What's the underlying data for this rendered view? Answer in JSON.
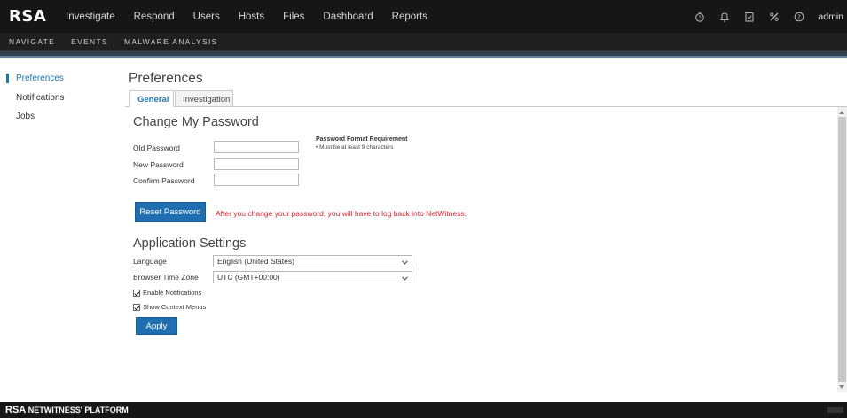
{
  "brand": "RSA",
  "topnav": {
    "items": [
      "Investigate",
      "Respond",
      "Users",
      "Hosts",
      "Files",
      "Dashboard",
      "Reports"
    ],
    "icons": [
      "timer-icon",
      "bell-icon",
      "clipboard-check-icon",
      "tools-icon",
      "help-icon"
    ],
    "user": "admin"
  },
  "subnav": {
    "items": [
      "NAVIGATE",
      "EVENTS",
      "MALWARE ANALYSIS"
    ]
  },
  "sidebar": {
    "items": [
      {
        "label": "Preferences",
        "active": true
      },
      {
        "label": "Notifications",
        "active": false
      },
      {
        "label": "Jobs",
        "active": false
      }
    ]
  },
  "page": {
    "title": "Preferences",
    "tabs": [
      "General",
      "Investigation"
    ],
    "active_tab": "General"
  },
  "password_section": {
    "title": "Change My Password",
    "fields": {
      "old": {
        "label": "Old Password",
        "value": ""
      },
      "new": {
        "label": "New Password",
        "value": ""
      },
      "confirm": {
        "label": "Confirm Password",
        "value": ""
      }
    },
    "requirement_title": "Password Format Requirement",
    "requirement_item": "• Must be at least 9 characters",
    "reset_button": "Reset Password",
    "warning": "After you change your password, you will have to log back into NetWitness."
  },
  "app_settings": {
    "title": "Application Settings",
    "language_label": "Language",
    "language_value": "English (United States)",
    "timezone_label": "Browser Time Zone",
    "timezone_value": "UTC (GMT+00:00)",
    "enable_notifications": {
      "label": "Enable Notifications",
      "checked": true
    },
    "show_context_menus": {
      "label": "Show Context Menus",
      "checked": true
    },
    "apply_button": "Apply"
  },
  "footer": {
    "logo": "RSA",
    "platform": "NETWITNESS' PLATFORM"
  },
  "colors": {
    "topbar": "#161616",
    "accent": "#1f76b5",
    "button": "#1f6fb0",
    "warning": "#d9262b",
    "band": "#34404c"
  }
}
